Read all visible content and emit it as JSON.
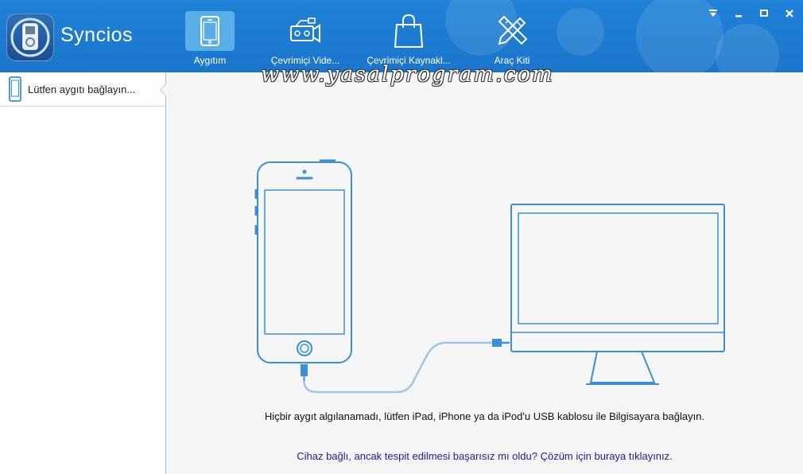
{
  "app": {
    "title": "Syncios"
  },
  "nav": [
    {
      "label": "Aygıtım",
      "icon": "phone-icon",
      "active": true
    },
    {
      "label": "Çevrimiçi Vide...",
      "icon": "camcorder-icon",
      "active": false
    },
    {
      "label": "Çevrimiçi Kaynakl...",
      "icon": "shopping-bag-icon",
      "active": false
    },
    {
      "label": "Araç Kiti",
      "icon": "pencil-ruler-icon",
      "active": false
    }
  ],
  "window_controls": [
    "dropdown-icon",
    "minimize-icon",
    "maximize-icon",
    "close-icon"
  ],
  "watermark": "www.yasalprogram.com",
  "sidebar": {
    "items": [
      {
        "label": "Lütfen aygıtı bağlayın...",
        "icon": "phone-icon"
      }
    ]
  },
  "main": {
    "message": "Hiçbir aygıt algılanamadı, lütfen iPad, iPhone ya da iPod'u USB kablosu ile Bilgisayara bağlayın.",
    "help_link": "Cihaz bağlı, ancak tespit edilmesi başarısız mı oldu? Çözüm için buraya tıklayınız."
  },
  "colors": {
    "topbar": "#1a76cc",
    "accent": "#3a8fd8",
    "active_nav": "#5aaee8",
    "link": "#1a1aa8"
  }
}
